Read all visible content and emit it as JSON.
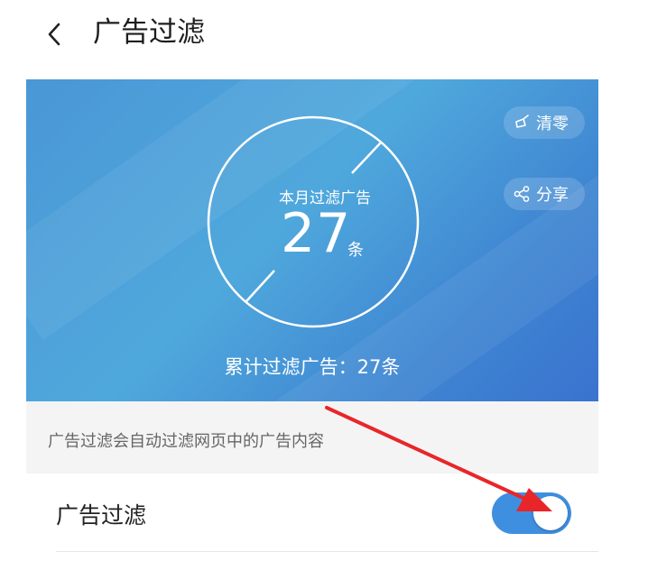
{
  "header": {
    "title": "广告过滤",
    "back_icon": "chevron-left-icon"
  },
  "hero": {
    "month_label": "本月过滤广告",
    "month_count": "27",
    "month_unit": "条",
    "total_label": "累计过滤广告：27条",
    "clear_label": "清零",
    "clear_icon": "broom-icon",
    "share_label": "分享",
    "share_icon": "share-icon",
    "gradient_start": "#4a97d6",
    "gradient_end": "#3a73cf"
  },
  "description": {
    "text": "广告过滤会自动过滤网页中的广告内容"
  },
  "settings": {
    "ad_filter_label": "广告过滤",
    "ad_filter_enabled": true,
    "toggle_color": "#3f8fe0"
  },
  "annotation": {
    "arrow_color": "#e8262a"
  }
}
